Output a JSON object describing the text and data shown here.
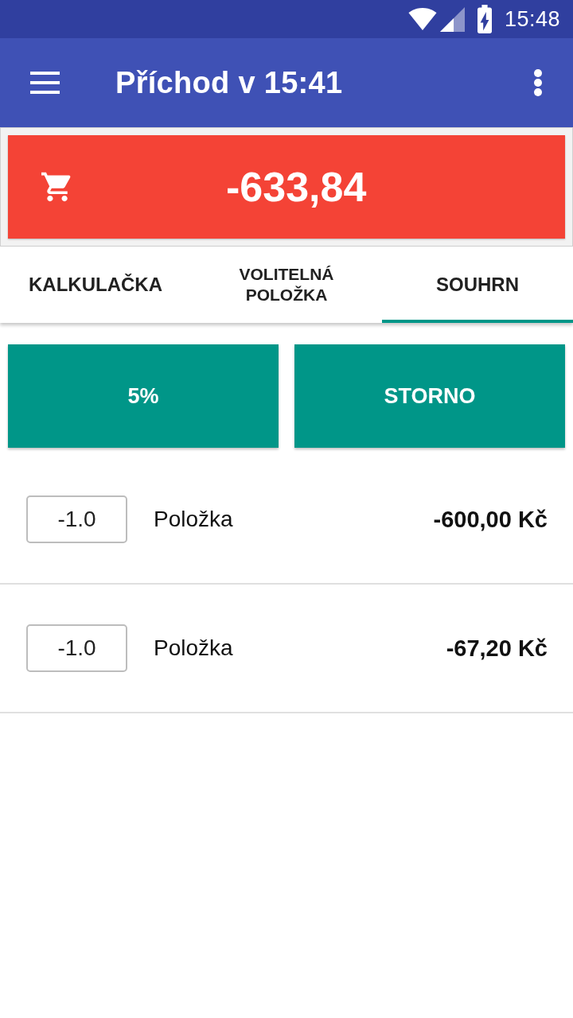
{
  "status_bar": {
    "time": "15:48"
  },
  "app_bar": {
    "title": "Příchod v 15:41"
  },
  "total": {
    "amount": "-633,84"
  },
  "tabs": [
    {
      "label": "KALKULAČKA",
      "selected": false
    },
    {
      "label": "VOLITELNÁ POLOŽKA",
      "selected": false
    },
    {
      "label": "SOUHRN",
      "selected": true
    }
  ],
  "actions": [
    "5%",
    "STORNO"
  ],
  "items": [
    {
      "quantity": "-1.0",
      "name": "Položka",
      "price": "-600,00 Kč"
    },
    {
      "quantity": "-1.0",
      "name": "Položka",
      "price": "-67,20 Kč"
    }
  ]
}
